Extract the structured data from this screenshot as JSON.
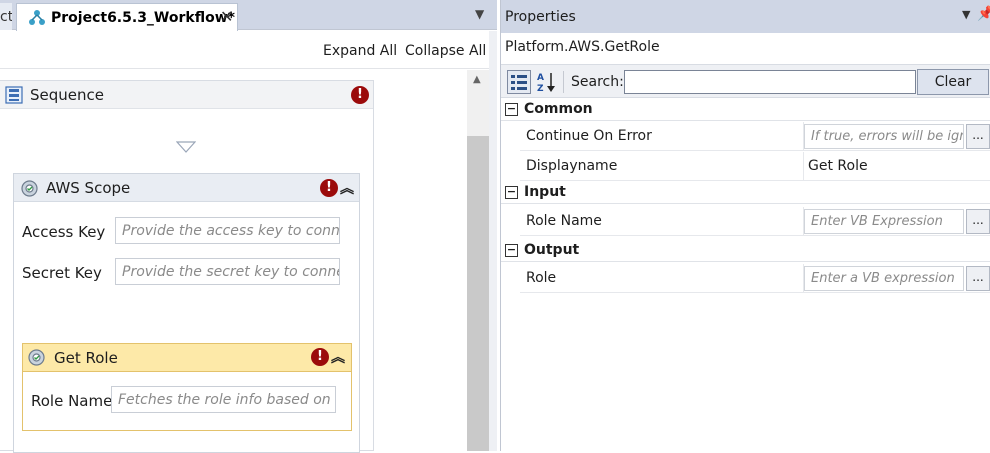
{
  "designer": {
    "prev_tab_fragment": "ct",
    "tab_title": "Project6.5.3_Workflow*",
    "tab_close": "✕",
    "toolbar": {
      "expand_all": "Expand All",
      "collapse_all": "Collapse All"
    },
    "sequence": {
      "title": "Sequence",
      "error": "!"
    },
    "aws_scope": {
      "title": "AWS Scope",
      "error": "!",
      "access_key_label": "Access Key",
      "access_key_placeholder": "Provide the access key to connect",
      "secret_key_label": "Secret Key",
      "secret_key_placeholder": "Provide the secret key to connect"
    },
    "get_role": {
      "title": "Get Role",
      "error": "!",
      "role_name_label": "Role Name",
      "role_name_placeholder": "Fetches the role info based on name"
    }
  },
  "properties": {
    "panel_title": "Properties",
    "selected_activity": "Platform.AWS.GetRole",
    "search_label": "Search:",
    "search_value": "",
    "clear_label": "Clear",
    "categories": [
      {
        "name": "Common",
        "rows": [
          {
            "name": "Continue On Error",
            "placeholder": "If true, errors will be ignored",
            "value": ""
          },
          {
            "name": "Displayname",
            "value": "Get Role"
          }
        ]
      },
      {
        "name": "Input",
        "rows": [
          {
            "name": "Role Name",
            "placeholder": "Enter VB Expression",
            "value": ""
          }
        ]
      },
      {
        "name": "Output",
        "rows": [
          {
            "name": "Role",
            "placeholder": "Enter a VB expression",
            "value": ""
          }
        ]
      }
    ],
    "ellipsis": "...",
    "collapse_glyph": "−"
  }
}
